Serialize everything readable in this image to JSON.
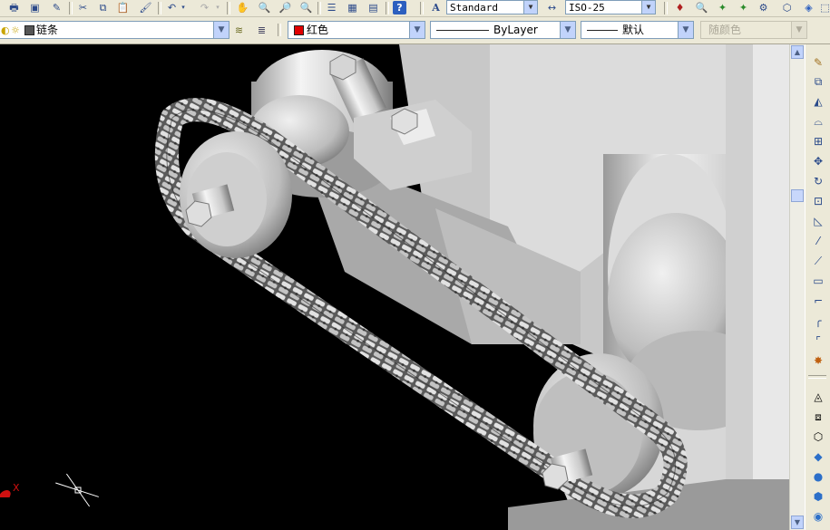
{
  "toolbar": {
    "icons_left": [
      "print-icon",
      "print-preview-icon",
      "publish-icon",
      "cut-icon",
      "copy-icon",
      "paste-icon",
      "match-properties-icon",
      "undo-icon",
      "redo-icon",
      "pan-icon",
      "zoom-realtime-icon",
      "zoom-window-icon",
      "zoom-previous-icon",
      "properties-icon",
      "design-center-icon",
      "tool-palettes-icon",
      "help-icon"
    ],
    "text_style": "Standard",
    "dim_style": "ISO-25",
    "icons_right": [
      "layer-tool-icon-1",
      "layer-tool-icon-2",
      "layer-tool-icon-3",
      "layer-tool-icon-4",
      "layer-tool-icon-5",
      "layer-tool-icon-6"
    ]
  },
  "properties": {
    "layer_name": "链条",
    "color_name": "红色",
    "color_hex": "#e00000",
    "linetype": "ByLayer",
    "lineweight": "默认",
    "plotstyle": "随颜色"
  },
  "scene": {
    "background": "#000000",
    "ucs_x_label": "X"
  },
  "modify_toolbar": {
    "icons": [
      "erase-icon",
      "copy-object-icon",
      "mirror-icon",
      "offset-icon",
      "array-icon",
      "move-icon",
      "rotate-icon",
      "scale-icon",
      "stretch-icon",
      "trim-icon",
      "extend-icon",
      "break-icon",
      "chamfer-icon",
      "fillet-icon",
      "explode-icon",
      "extrude-icon",
      "revolve-icon",
      "box-icon",
      "solid-icon",
      "sphere-icon",
      "cylinder-icon",
      "cone-icon"
    ]
  }
}
